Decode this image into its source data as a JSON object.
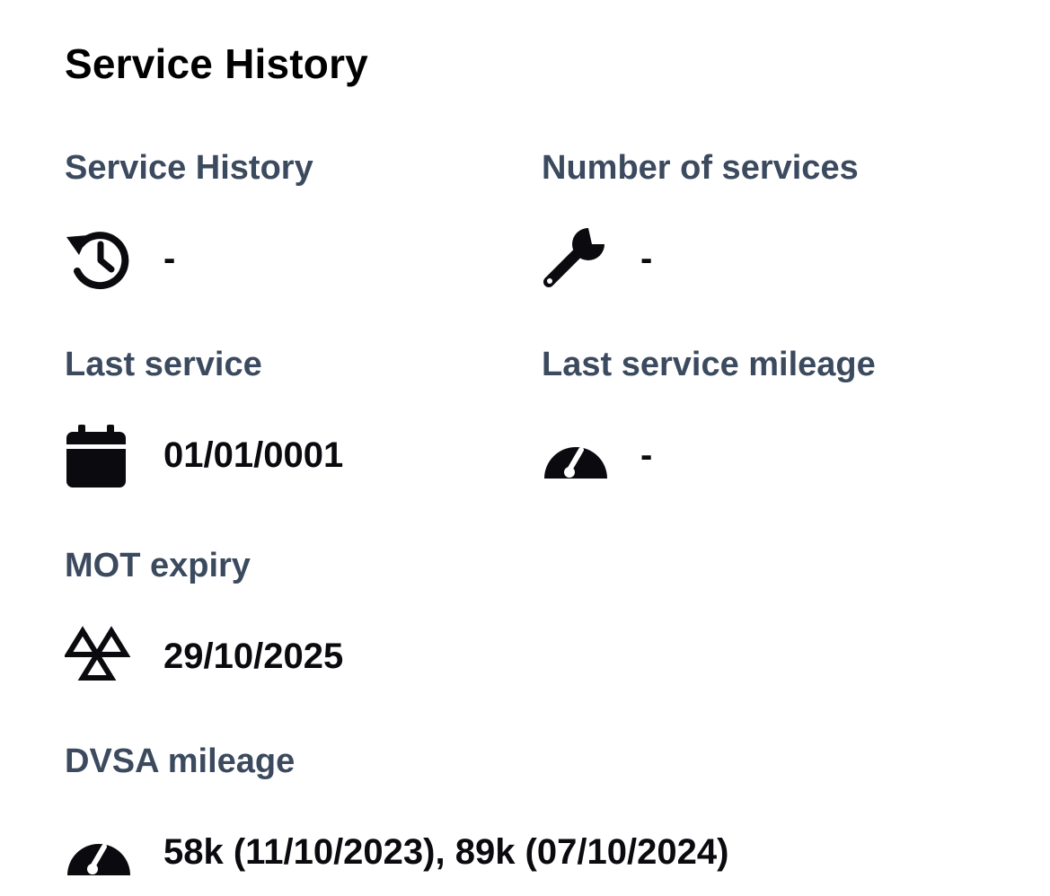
{
  "section": {
    "title": "Service History"
  },
  "fields": {
    "service_history": {
      "label": "Service History",
      "value": "-",
      "icon": "history-icon"
    },
    "number_of_services": {
      "label": "Number of services",
      "value": "-",
      "icon": "wrench-icon"
    },
    "last_service": {
      "label": "Last service",
      "value": "01/01/0001",
      "icon": "calendar-icon"
    },
    "last_service_mileage": {
      "label": "Last service mileage",
      "value": "-",
      "icon": "gauge-icon"
    },
    "mot_expiry": {
      "label": "MOT expiry",
      "value": "29/10/2025",
      "icon": "mot-triangles-icon"
    },
    "dvsa_mileage": {
      "label": "DVSA mileage",
      "value": "58k (11/10/2023), 89k (07/10/2024)",
      "icon": "gauge-icon"
    }
  },
  "colors": {
    "label": "#3b4a5e",
    "value": "#0a0a0f",
    "icon": "#0a0a0f",
    "background": "#ffffff"
  }
}
